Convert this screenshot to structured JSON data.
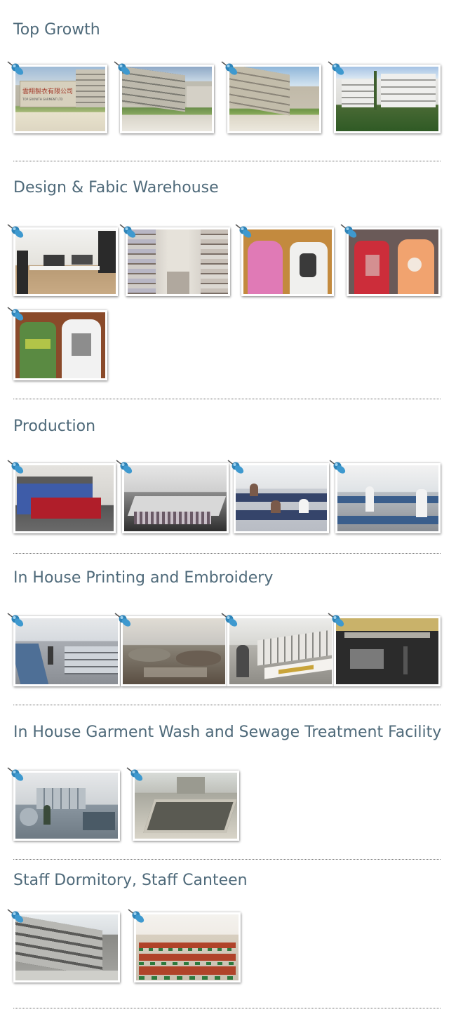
{
  "sections": [
    {
      "title": "Top Growth",
      "photos": [
        {
          "name": "photo-factory-entrance-sign",
          "icon": "photo-icon",
          "palette": [
            "#cfc9b8",
            "#9b9a91",
            "#88a460",
            "#e8e2cc"
          ],
          "sign_text": "雲翔製衣有限公司",
          "sign_subtext": "TOP GROWTH GARMENT LTD"
        },
        {
          "name": "photo-factory-building-side",
          "icon": "photo-icon",
          "palette": [
            "#bdbbb0",
            "#8fa9c6",
            "#6c8f4c",
            "#d8d4c8"
          ]
        },
        {
          "name": "photo-factory-building-road",
          "icon": "photo-icon",
          "palette": [
            "#c0b9a8",
            "#8fb6d9",
            "#6d9545",
            "#dcd6c6"
          ]
        },
        {
          "name": "photo-factory-building-front",
          "icon": "photo-icon",
          "palette": [
            "#e8e8e6",
            "#a6c3e4",
            "#2f5a25",
            "#4a6a35"
          ]
        }
      ]
    },
    {
      "title": "Design & Fabic Warehouse",
      "photos": [
        {
          "name": "photo-design-office",
          "icon": "photo-icon",
          "palette": [
            "#e4e2dc",
            "#2a2a2a",
            "#b89a74",
            "#f4f4f2"
          ]
        },
        {
          "name": "photo-fabric-warehouse",
          "icon": "photo-icon",
          "palette": [
            "#cfcac4",
            "#9aa2b4",
            "#7a6e66",
            "#e6e2da"
          ]
        },
        {
          "name": "photo-samples-hoodie-tee",
          "icon": "photo-icon",
          "palette": [
            "#c38a3e",
            "#e07ab6",
            "#f0f0ee",
            "#3a3a3a"
          ]
        },
        {
          "name": "photo-samples-red-tee-jacket",
          "icon": "photo-icon",
          "palette": [
            "#6a5a58",
            "#cc2d3a",
            "#f1a36f",
            "#f2e8de"
          ]
        },
        {
          "name": "photo-samples-green-tee-jacket",
          "icon": "photo-icon",
          "palette": [
            "#8a4a2a",
            "#5a8a42",
            "#f2f2f2",
            "#3a3a3a"
          ]
        }
      ]
    },
    {
      "title": "Production",
      "photos": [
        {
          "name": "photo-production-cutting-machine",
          "icon": "photo-icon",
          "palette": [
            "#e4e2de",
            "#3e5ca8",
            "#b01e2a",
            "#555555"
          ]
        },
        {
          "name": "photo-production-cutting-table",
          "icon": "photo-icon",
          "palette": [
            "#d8d8d8",
            "#5f5f5f",
            "#cfcfcf",
            "#2e2e2e"
          ]
        },
        {
          "name": "photo-production-sewing-line-1",
          "icon": "photo-icon",
          "palette": [
            "#e2e4e6",
            "#35446a",
            "#f4f4f4",
            "#7a5a4a"
          ]
        },
        {
          "name": "photo-production-sewing-line-2",
          "icon": "photo-icon",
          "palette": [
            "#dfe3e6",
            "#3a5e8c",
            "#f2f2f2",
            "#6a6a6a"
          ]
        }
      ]
    },
    {
      "title": "In House Printing and Embroidery",
      "photos": [
        {
          "name": "photo-printing-floor",
          "icon": "photo-icon",
          "palette": [
            "#d6dadf",
            "#4e6f96",
            "#a8acb2",
            "#e6e8ea"
          ]
        },
        {
          "name": "photo-printing-carousel",
          "icon": "photo-icon",
          "palette": [
            "#c8c6c2",
            "#5a4e42",
            "#8a8478",
            "#e0dcd4"
          ]
        },
        {
          "name": "photo-embroidery-machines",
          "icon": "photo-icon",
          "palette": [
            "#d6d6d2",
            "#e8e6e2",
            "#9a3a2a",
            "#4a4a4a"
          ]
        },
        {
          "name": "photo-embroidery-laser-table",
          "icon": "photo-icon",
          "palette": [
            "#2b2b2b",
            "#c9b26a",
            "#e8e4d8",
            "#7a7a7a"
          ]
        }
      ]
    },
    {
      "title": "In House Garment Wash and Sewage Treatment Facility",
      "photos": [
        {
          "name": "photo-garment-wash",
          "icon": "photo-icon",
          "palette": [
            "#cfd3d6",
            "#8a96a0",
            "#4a5a66",
            "#e6e8ea"
          ]
        },
        {
          "name": "photo-sewage-treatment",
          "icon": "photo-icon",
          "palette": [
            "#bfc0ba",
            "#7a786e",
            "#d8d4c8",
            "#5a5a52"
          ]
        }
      ]
    },
    {
      "title": "Staff Dormitory, Staff Canteen",
      "photos": [
        {
          "name": "photo-staff-dormitory",
          "icon": "photo-icon",
          "palette": [
            "#d9dde0",
            "#8a8a86",
            "#5a5a58",
            "#e8ecee"
          ]
        },
        {
          "name": "photo-staff-canteen",
          "icon": "photo-icon",
          "palette": [
            "#f0ece6",
            "#b0432a",
            "#2e7a3e",
            "#d8cfc0"
          ]
        }
      ]
    }
  ]
}
